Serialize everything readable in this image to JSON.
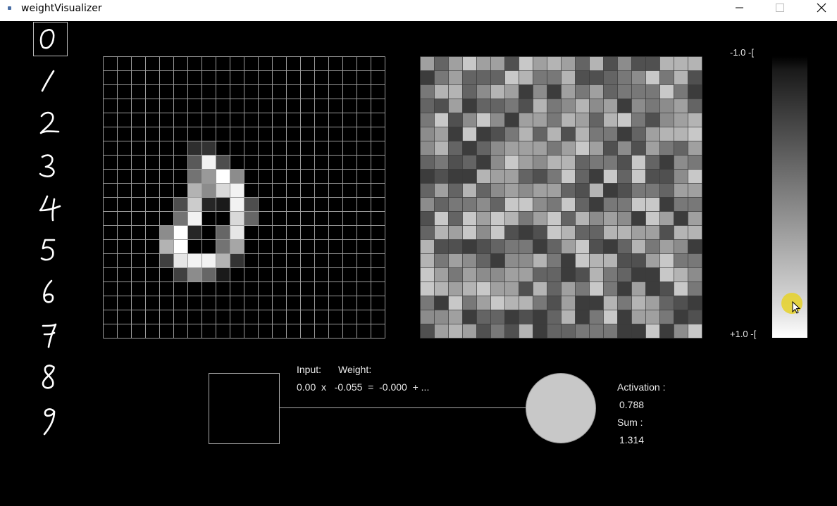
{
  "window": {
    "title": "weightVisualizer",
    "minimize_icon": "minimize-icon",
    "maximize_icon": "maximize-icon",
    "close_icon": "close-icon"
  },
  "digits": {
    "items": [
      "0",
      "1",
      "2",
      "3",
      "4",
      "5",
      "6",
      "7",
      "8",
      "9"
    ],
    "selected": "0"
  },
  "input_image": {
    "size": 20,
    "note_pixels": [
      [
        6,
        6,
        0.18
      ],
      [
        6,
        7,
        0.2
      ],
      [
        7,
        6,
        0.35
      ],
      [
        7,
        7,
        0.95
      ],
      [
        7,
        8,
        0.3
      ],
      [
        8,
        6,
        0.45
      ],
      [
        8,
        7,
        0.6
      ],
      [
        8,
        8,
        1.0
      ],
      [
        8,
        9,
        0.55
      ],
      [
        9,
        6,
        0.7
      ],
      [
        9,
        7,
        0.55
      ],
      [
        9,
        8,
        0.85
      ],
      [
        9,
        9,
        0.95
      ],
      [
        10,
        5,
        0.3
      ],
      [
        10,
        6,
        0.8
      ],
      [
        10,
        7,
        0.15
      ],
      [
        10,
        8,
        0.1
      ],
      [
        10,
        9,
        0.95
      ],
      [
        10,
        10,
        0.3
      ],
      [
        11,
        5,
        0.45
      ],
      [
        11,
        6,
        0.95
      ],
      [
        11,
        7,
        0.0
      ],
      [
        11,
        8,
        0.0
      ],
      [
        11,
        9,
        0.85
      ],
      [
        11,
        10,
        0.4
      ],
      [
        12,
        4,
        0.55
      ],
      [
        12,
        5,
        1.0
      ],
      [
        12,
        6,
        0.15
      ],
      [
        12,
        8,
        0.4
      ],
      [
        12,
        9,
        0.9
      ],
      [
        13,
        4,
        0.7
      ],
      [
        13,
        5,
        1.0
      ],
      [
        13,
        8,
        0.45
      ],
      [
        13,
        9,
        0.65
      ],
      [
        14,
        4,
        0.25
      ],
      [
        14,
        5,
        0.9
      ],
      [
        14,
        6,
        0.95
      ],
      [
        14,
        7,
        0.95
      ],
      [
        14,
        8,
        0.7
      ],
      [
        14,
        9,
        0.2
      ],
      [
        15,
        5,
        0.25
      ],
      [
        15,
        6,
        0.55
      ],
      [
        15,
        7,
        0.4
      ],
      [
        15,
        8,
        0.1
      ]
    ]
  },
  "weights": {
    "size": 20
  },
  "scale": {
    "top_label": "-1.0 -[",
    "bottom_label": "+1.0 -[",
    "top_value": -1.0,
    "bottom_value": 1.0
  },
  "computation": {
    "input_label": "Input:",
    "weight_label": "Weight:",
    "equation": "0.00  x   -0.055  =  -0.000  + ...",
    "activation_label": "Activation :",
    "activation_value": "0.788",
    "sum_label": "Sum :",
    "sum_value": "1.314"
  }
}
